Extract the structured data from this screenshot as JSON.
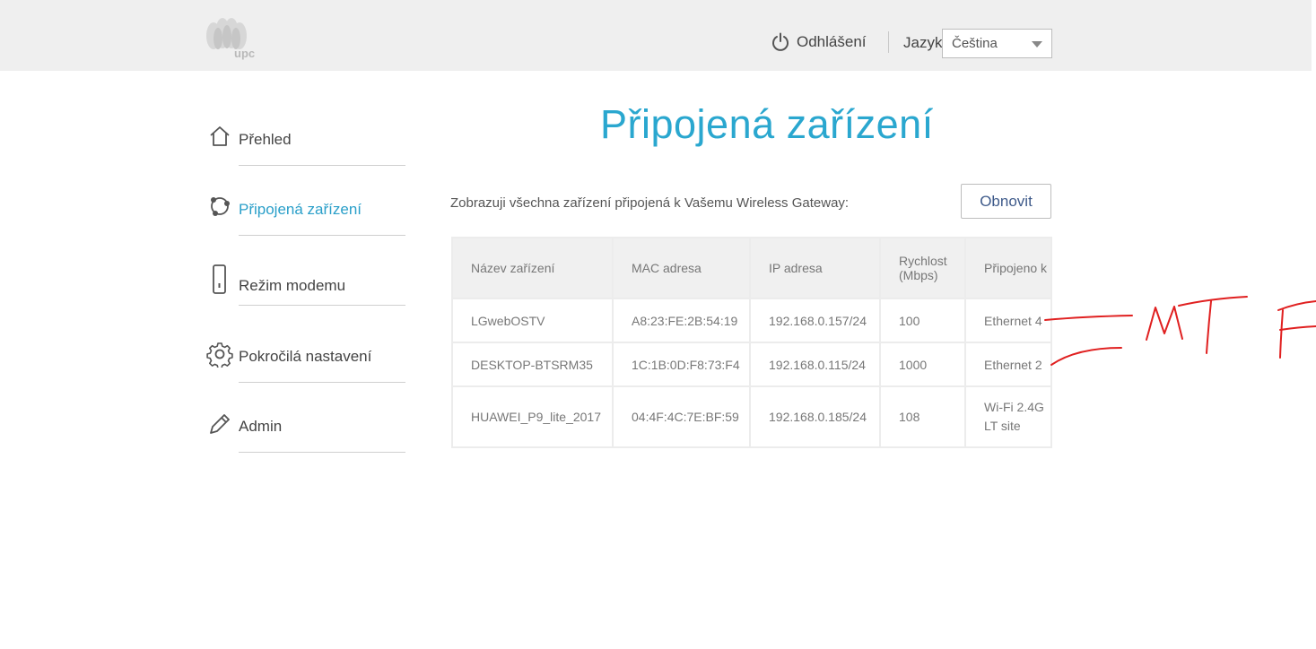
{
  "header": {
    "logo_text": "upc",
    "logout_label": "Odhlášení",
    "language_label": "Jazyk",
    "language_value": "Čeština"
  },
  "sidebar": {
    "items": [
      {
        "label": "Přehled",
        "icon": "home-icon"
      },
      {
        "label": "Připojená zařízení",
        "icon": "devices-icon",
        "active": true
      },
      {
        "label": "Režim modemu",
        "icon": "modem-icon"
      },
      {
        "label": "Pokročilá nastavení",
        "icon": "gear-icon"
      },
      {
        "label": "Admin",
        "icon": "pencil-icon"
      }
    ]
  },
  "main": {
    "title": "Připojená zařízení",
    "description": "Zobrazuji všechna zařízení připojená k Vašemu Wireless Gateway:",
    "refresh_label": "Obnovit",
    "table": {
      "headers": [
        "Název zařízení",
        "MAC adresa",
        "IP adresa",
        "Rychlost (Mbps)",
        "Připojeno k"
      ],
      "rows": [
        [
          "LGwebOSTV",
          "A8:23:FE:2B:54:19",
          "192.168.0.157/24",
          "100",
          "Ethernet 4"
        ],
        [
          "DESKTOP-BTSRM35",
          "1C:1B:0D:F8:73:F4",
          "192.168.0.115/24",
          "1000",
          "Ethernet 2"
        ],
        [
          "HUAWEI_P9_lite_2017",
          "04:4F:4C:7E:BF:59",
          "192.168.0.185/24",
          "108",
          "Wi-Fi 2.4G LT site"
        ]
      ]
    }
  },
  "colors": {
    "accent": "#2aa7cf",
    "header_bg": "#efefef",
    "scribble": "#e02020"
  }
}
